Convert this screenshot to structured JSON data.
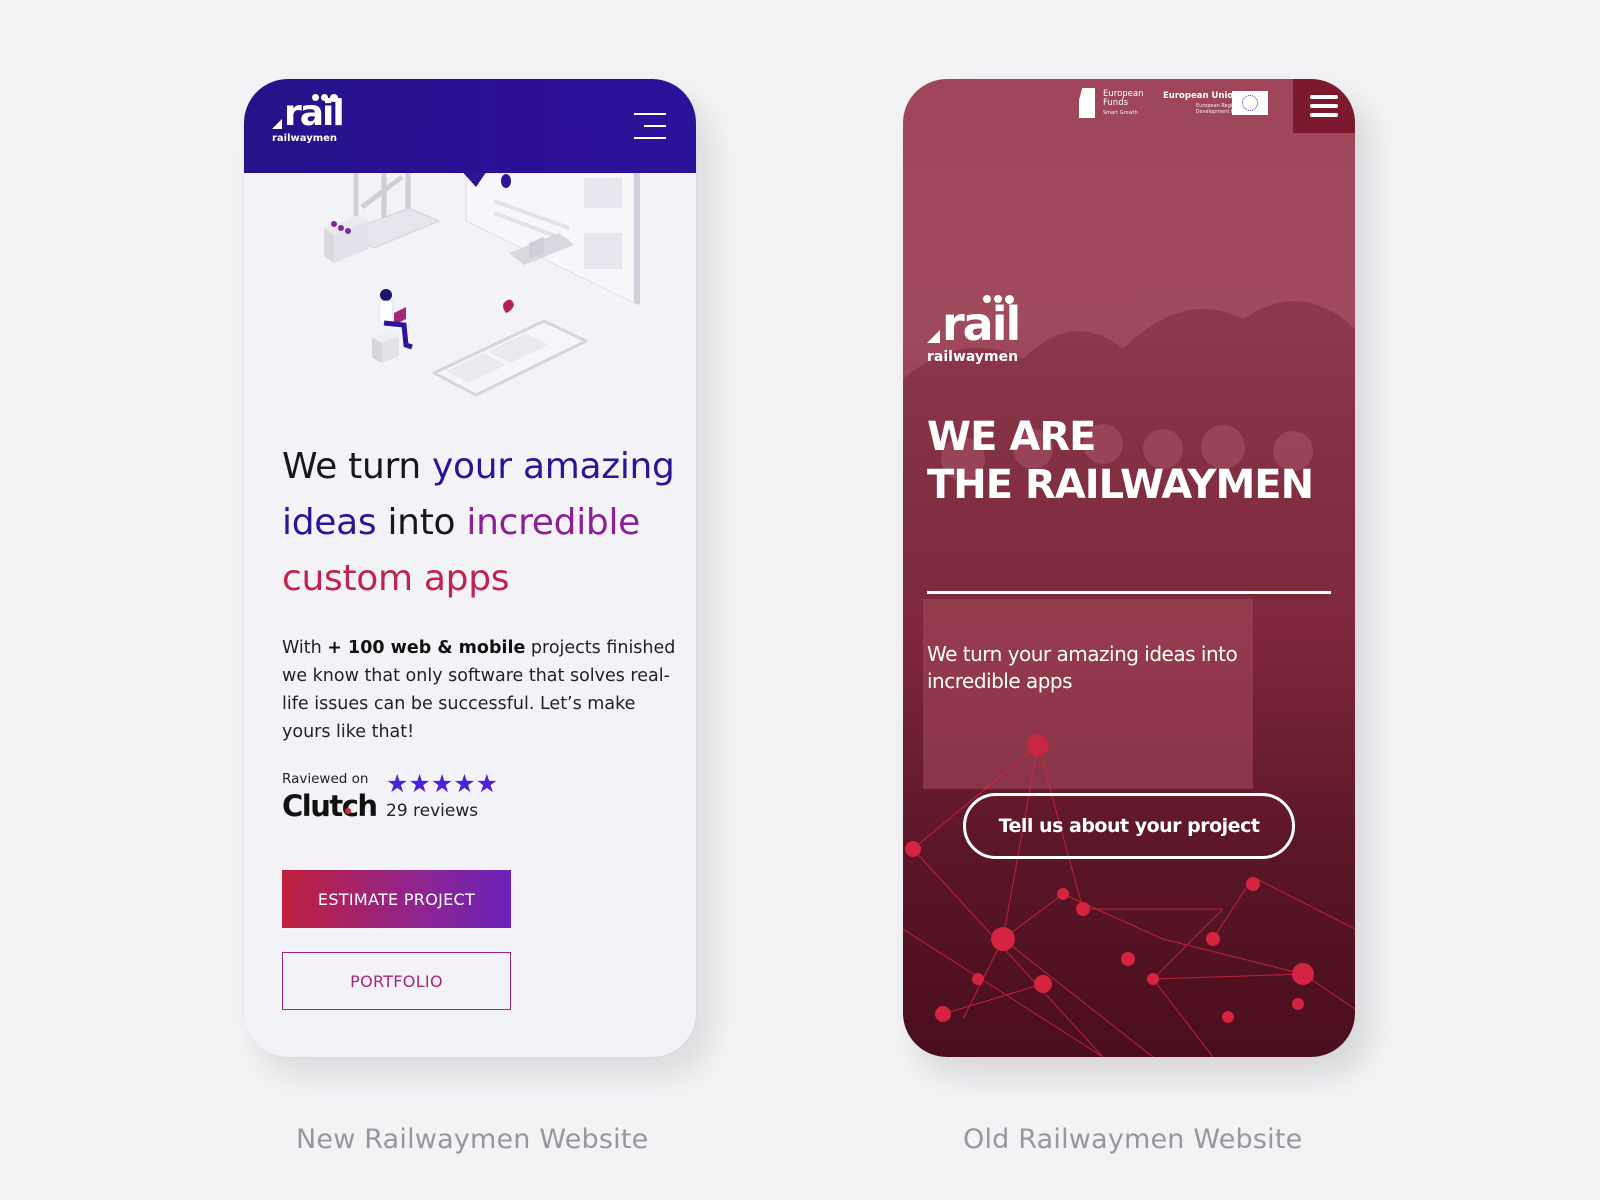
{
  "new_site": {
    "logo": {
      "word": "rail",
      "sub": "railwaymen"
    },
    "menu_icon": "hamburger-icon",
    "illustration": "isometric-devices-illustration",
    "hero_title": {
      "part1": "We turn ",
      "part2": "your amazing",
      "part3": "ideas",
      "part4": " into ",
      "part5": "incredible",
      "part6": "custom apps"
    },
    "hero_body": {
      "part1": "With ",
      "bold": "+ 100 web & mobile",
      "part2": " projects finished we know that only software that solves real-life issues can be successful. Let’s make yours like that!"
    },
    "review": {
      "label": "Raviewed on",
      "brand": "Clutch",
      "stars": "★★★★★",
      "rating": 5,
      "count": "29 reviews"
    },
    "buttons": {
      "estimate": "ESTIMATE PROJECT",
      "portfolio": "PORTFOLIO"
    },
    "colors": {
      "header": "#2a1296",
      "accent_blue": "#2a1596",
      "accent_purple": "#8a2195",
      "accent_red": "#c3224f",
      "star": "#4b22d6"
    }
  },
  "old_site": {
    "eu_funds": {
      "title": "European Funds",
      "subtitle": "Smart Growth"
    },
    "eu_union": {
      "title": "European Union",
      "subtitle": "European Regional Development Fund"
    },
    "menu_icon": "hamburger-icon",
    "logo": {
      "word": "rail",
      "sub": "railwaymen"
    },
    "title_line1": "WE ARE",
    "title_line2": "THE RAILWAYMEN",
    "subtitle": "We turn your amazing ideas into incredible apps",
    "cta": "Tell us about your project",
    "colors": {
      "overlay": "#9e4559",
      "menu_box": "#7b1a2c",
      "network": "#d4243f"
    }
  },
  "captions": {
    "new": "New Railwaymen Website",
    "old": "Old Railwaymen Website"
  }
}
